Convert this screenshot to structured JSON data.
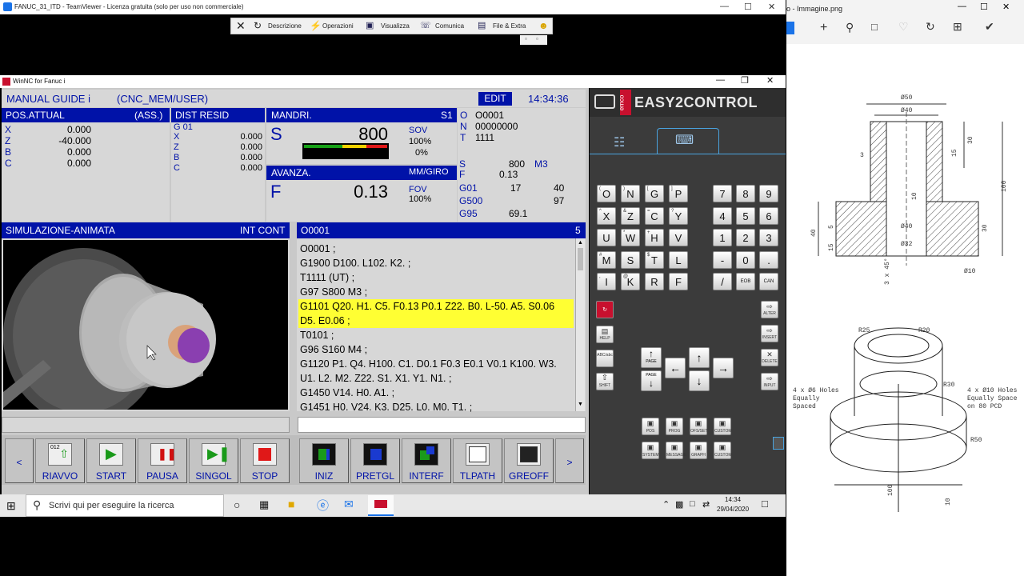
{
  "teamviewer": {
    "title": "FANUC_31_ITD - TeamViewer - Licenza gratuita (solo per uso non commerciale)",
    "toolbar": {
      "description": "Descrizione",
      "operations": "Operazioni",
      "view": "Visualizza",
      "communicate": "Comunica",
      "files": "File & Extra"
    }
  },
  "winnc": {
    "title": "WinNC for Fanuc i"
  },
  "cnc": {
    "mode": "MANUAL GUIDE i",
    "mem": "(CNC_MEM/USER)",
    "edit": "EDIT",
    "time": "14:34:36",
    "pos_title": "POS.ATTUAL",
    "pos_abs": "(ASS.)",
    "pos_axes": [
      "X",
      "Z",
      "B",
      "C"
    ],
    "pos_values": [
      "0.000",
      "-40.000",
      "0.000",
      "0.000"
    ],
    "dist_title": "DIST RESID",
    "dist_g": "G 01",
    "dist_axes": [
      "X",
      "Z",
      "B",
      "C"
    ],
    "dist_values": [
      "0.000",
      "0.000",
      "0.000",
      "0.000"
    ],
    "spindle_title": "MANDRI.",
    "spindle_id": "S1",
    "s_letter": "S",
    "s_value": "800",
    "sov_label": "SOV",
    "sov_value": "100%",
    "sov_zero": "0%",
    "feed_title": "AVANZA.",
    "feed_unit": "MM/GIRO",
    "f_letter": "F",
    "f_value": "0.13",
    "fov_label": "FOV",
    "fov_value": "100%",
    "o_label": "O",
    "o_value": "O0001",
    "n_label": "N",
    "n_value": "00000000",
    "t_label": "T",
    "t_value": "1111",
    "modal": [
      [
        "S",
        "800",
        "M3"
      ],
      [
        "F",
        "0.13",
        ""
      ],
      [
        "G01",
        "17",
        "40"
      ],
      [
        "G500",
        "",
        "97"
      ],
      [
        "G95",
        "69.1",
        ""
      ]
    ],
    "sim_title": "SIMULAZIONE-ANIMATA",
    "sim_mode": "INT CONT",
    "prog_title": "O0001",
    "prog_page": "5",
    "program": [
      "O0001 ;",
      "G1900 D100. L102. K2. ;",
      "T1111 (UT) ;",
      "G97 S800 M3 ;",
      "G1101 Q20. H1. C5. F0.13 P0.1 Z22. B0. L-50. A5. S0.06",
      "D5. E0.06 ;",
      "T0101 ;",
      "G96 S160 M4 ;",
      "G1120 P1. Q4. H100. C1. D0.1 F0.3 E0.1 V0.1 K100. W3.",
      "U1. L2. M2. Z22. S1. X1. Y1. N1. ;",
      "G1450 V14. H0. A1. ;",
      "G1451 H0. V24. K3. D25. L0. M0. T1. ;"
    ],
    "softkeys_left": [
      "RIAVVO",
      "START",
      "PAUSA",
      "SINGOL",
      "STOP"
    ],
    "softkeys_right": [
      "INIZ",
      "PRETGL",
      "INTERF",
      "TLPATH",
      "GREOFF"
    ],
    "sk_prev": "<",
    "sk_next": ">",
    "icon_counter": "012"
  },
  "emco": {
    "logo": "EASY2CONTROL",
    "brand": "emco",
    "keys": [
      [
        "O",
        "N",
        "G",
        "P"
      ],
      [
        "X",
        "Z",
        "C",
        "Y"
      ],
      [
        "U",
        "W",
        "H",
        "V"
      ],
      [
        "M",
        "S",
        "T",
        "L"
      ],
      [
        "I",
        "K",
        "R",
        "F"
      ]
    ],
    "keys_small": [
      [
        "(",
        ")",
        "[",
        "]"
      ],
      [
        "^",
        "&",
        "=",
        "?"
      ],
      [
        "",
        "*",
        "+",
        ""
      ],
      [
        "#",
        "",
        "$",
        ""
      ],
      [
        ",",
        "@",
        "",
        ""
      ]
    ],
    "numpad": [
      [
        "7",
        "8",
        "9"
      ],
      [
        "4",
        "5",
        "6"
      ],
      [
        "1",
        "2",
        "3"
      ],
      [
        "-",
        "0",
        "."
      ],
      [
        "/",
        "EOB",
        "CAN"
      ]
    ],
    "side_labels": [
      "HELP",
      "ABC/abc",
      "SHIFT"
    ],
    "edit_labels": [
      "ALTER",
      "INSERT",
      "DELETE",
      "INPUT"
    ],
    "page_labels": [
      "PAGE",
      "PAGE"
    ],
    "func_labels": [
      "POS",
      "PROG",
      "OFS/SET",
      "CUSTOM",
      "SYSTEM",
      "MESSAGE",
      "GRAPH",
      "CUSTOM"
    ]
  },
  "taskbar": {
    "search_placeholder": "Scrivi qui per eseguire la ricerca",
    "time": "14:34",
    "date": "29/04/2020"
  },
  "viewer": {
    "title": "o - Immagine.png",
    "drawing_top": {
      "dims": [
        "Ø50",
        "Ø40",
        "30",
        "15",
        "3",
        "100",
        "10",
        "30",
        "40",
        "15",
        "5",
        "Ø40",
        "Ø32",
        "3 x 45°",
        "Ø10"
      ]
    },
    "drawing_bottom": {
      "r25": "R25",
      "r20": "R20",
      "r30": "R30",
      "r50": "R50",
      "holes_left": [
        "4 x Ø6 Holes",
        "Equally",
        "Spaced"
      ],
      "holes_right": [
        "4 x Ø10 Holes",
        "Equally Space",
        "on 80 PCD"
      ],
      "dim_100": "100",
      "dim_10": "10"
    }
  },
  "colors": {
    "navy": "#0012a8",
    "highlight": "#ffff33",
    "emco_dark": "#3b3b3b",
    "emco_red": "#c8102e"
  }
}
